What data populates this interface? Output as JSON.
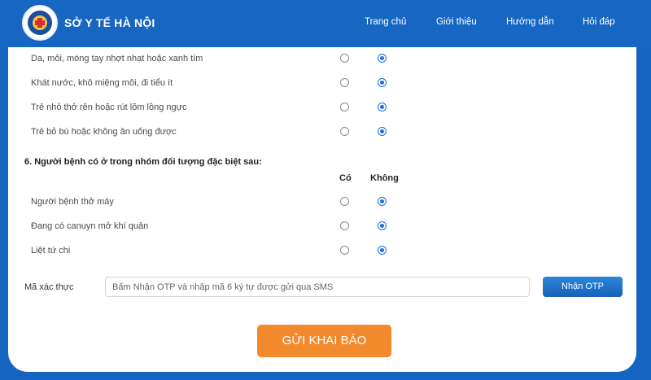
{
  "header": {
    "brand": "SỞ Y TẾ HÀ NỘI",
    "nav": [
      "Trang chủ",
      "Giới thiệu",
      "Hướng dẫn",
      "Hỏi đáp"
    ],
    "color": "#1766c1"
  },
  "symptoms": {
    "items": [
      {
        "label": "Da, môi, móng tay nhợt nhạt hoặc xanh tím",
        "selected": "no"
      },
      {
        "label": "Khát nước, khô miệng môi, đi tiểu ít",
        "selected": "no"
      },
      {
        "label": "Trẻ nhỏ thở rên hoặc rút lõm lồng ngực",
        "selected": "no"
      },
      {
        "label": "Trẻ bỏ bú hoặc không ăn uống được",
        "selected": "no"
      }
    ]
  },
  "section6": {
    "title": "6. Người bệnh có ở trong nhóm đối tượng đặc biệt sau:",
    "col_yes": "Có",
    "col_no": "Không",
    "items": [
      {
        "label": "Người bệnh thở máy",
        "selected": "no"
      },
      {
        "label": "Đang có canuyn mở khí quản",
        "selected": "no"
      },
      {
        "label": "Liệt tứ chi",
        "selected": "no"
      }
    ]
  },
  "otp": {
    "label": "Mã xác thực",
    "placeholder": "Bấm Nhận OTP và nhập mã 6 ký tự được gửi qua SMS",
    "button": "Nhận OTP"
  },
  "submit": {
    "label": "GỬI KHAI BÁO",
    "color": "#f28a2d"
  }
}
